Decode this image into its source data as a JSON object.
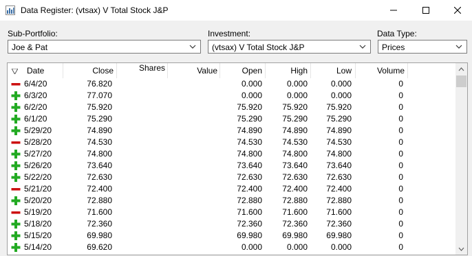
{
  "window": {
    "title": "Data Register: (vtsax) V Total Stock J&P"
  },
  "controls": {
    "sub_portfolio": {
      "label": "Sub-Portfolio:",
      "value": "Joe & Pat"
    },
    "investment": {
      "label": "Investment:",
      "value": "(vtsax) V Total Stock J&P"
    },
    "data_type": {
      "label": "Data Type:",
      "value": "Prices"
    }
  },
  "table": {
    "columns": [
      "Date",
      "Close",
      "Shares",
      "Value",
      "Open",
      "High",
      "Low",
      "Volume"
    ],
    "rows": [
      {
        "icon": "minus-icon",
        "date": "6/4/20",
        "close": "76.820",
        "shares": "",
        "value": "",
        "open": "0.000",
        "high": "0.000",
        "low": "0.000",
        "volume": "0"
      },
      {
        "icon": "plus-icon",
        "date": "6/3/20",
        "close": "77.070",
        "shares": "",
        "value": "",
        "open": "0.000",
        "high": "0.000",
        "low": "0.000",
        "volume": "0"
      },
      {
        "icon": "plus-icon",
        "date": "6/2/20",
        "close": "75.920",
        "shares": "",
        "value": "",
        "open": "75.920",
        "high": "75.920",
        "low": "75.920",
        "volume": "0"
      },
      {
        "icon": "plus-icon",
        "date": "6/1/20",
        "close": "75.290",
        "shares": "",
        "value": "",
        "open": "75.290",
        "high": "75.290",
        "low": "75.290",
        "volume": "0"
      },
      {
        "icon": "plus-icon",
        "date": "5/29/20",
        "close": "74.890",
        "shares": "",
        "value": "",
        "open": "74.890",
        "high": "74.890",
        "low": "74.890",
        "volume": "0"
      },
      {
        "icon": "minus-icon",
        "date": "5/28/20",
        "close": "74.530",
        "shares": "",
        "value": "",
        "open": "74.530",
        "high": "74.530",
        "low": "74.530",
        "volume": "0"
      },
      {
        "icon": "plus-icon",
        "date": "5/27/20",
        "close": "74.800",
        "shares": "",
        "value": "",
        "open": "74.800",
        "high": "74.800",
        "low": "74.800",
        "volume": "0"
      },
      {
        "icon": "plus-icon",
        "date": "5/26/20",
        "close": "73.640",
        "shares": "",
        "value": "",
        "open": "73.640",
        "high": "73.640",
        "low": "73.640",
        "volume": "0"
      },
      {
        "icon": "plus-icon",
        "date": "5/22/20",
        "close": "72.630",
        "shares": "",
        "value": "",
        "open": "72.630",
        "high": "72.630",
        "low": "72.630",
        "volume": "0"
      },
      {
        "icon": "minus-icon",
        "date": "5/21/20",
        "close": "72.400",
        "shares": "",
        "value": "",
        "open": "72.400",
        "high": "72.400",
        "low": "72.400",
        "volume": "0"
      },
      {
        "icon": "plus-icon",
        "date": "5/20/20",
        "close": "72.880",
        "shares": "",
        "value": "",
        "open": "72.880",
        "high": "72.880",
        "low": "72.880",
        "volume": "0"
      },
      {
        "icon": "minus-icon",
        "date": "5/19/20",
        "close": "71.600",
        "shares": "",
        "value": "",
        "open": "71.600",
        "high": "71.600",
        "low": "71.600",
        "volume": "0"
      },
      {
        "icon": "plus-icon",
        "date": "5/18/20",
        "close": "72.360",
        "shares": "",
        "value": "",
        "open": "72.360",
        "high": "72.360",
        "low": "72.360",
        "volume": "0"
      },
      {
        "icon": "plus-icon",
        "date": "5/15/20",
        "close": "69.980",
        "shares": "",
        "value": "",
        "open": "69.980",
        "high": "69.980",
        "low": "69.980",
        "volume": "0"
      },
      {
        "icon": "plus-icon",
        "date": "5/14/20",
        "close": "69.620",
        "shares": "",
        "value": "",
        "open": "0.000",
        "high": "0.000",
        "low": "0.000",
        "volume": "0"
      }
    ]
  },
  "colors": {
    "plus": "#22aa22",
    "minus": "#cc1111"
  }
}
